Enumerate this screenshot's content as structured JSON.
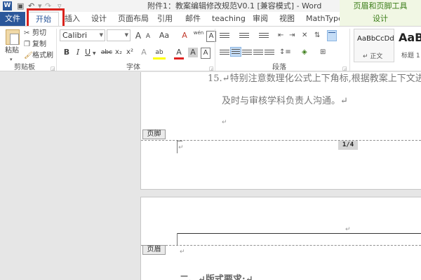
{
  "title_bar": {
    "app_icon": "W",
    "undo": "↶",
    "redo": "↷",
    "save": "💾",
    "title": "附件1：教案编辑修改规范V0.1 [兼容模式] - Word",
    "context_group": "页眉和页脚工具"
  },
  "tabs": {
    "file": "文件",
    "home": "开始",
    "items": [
      "插入",
      "设计",
      "页面布局",
      "引用",
      "邮件",
      "teaching",
      "审阅",
      "视图",
      "MathType"
    ],
    "context": "设计"
  },
  "ribbon": {
    "clipboard": {
      "paste": "粘贴",
      "cut": "剪切",
      "copy": "复制",
      "format_painter": "格式刷",
      "label": "剪贴板"
    },
    "font": {
      "name": "Calibri",
      "size": "",
      "grow": "A",
      "shrink": "A",
      "case": "Aa",
      "clear": "A",
      "wen": "wén",
      "bold": "B",
      "italic": "I",
      "underline": "U",
      "strike": "abc",
      "subscript": "x₂",
      "superscript": "x²",
      "effects": "A",
      "highlight": "ab",
      "color": "A",
      "shade": "A",
      "border": "A",
      "label": "字体"
    },
    "paragraph": {
      "label": "段落"
    },
    "styles": {
      "normal_sample": "AaBbCcDd",
      "normal_name": "↵ 正文",
      "h1_sample": "AaB",
      "h1_name": "标题 1"
    }
  },
  "document": {
    "line1": "15.↵特别注意数理化公式上下角标,根据教案上下文进",
    "line2": "及时与审核学科负责人沟通。↵",
    "para_mark": "↵",
    "footer_tag": "页脚",
    "page_number": "1/4",
    "header_tag": "页眉",
    "heading": "二、↵版式要求:↵"
  },
  "colors": {
    "accent": "#2b579a",
    "highlight_red": "#d9221c",
    "context_green": "#3a7c17"
  }
}
